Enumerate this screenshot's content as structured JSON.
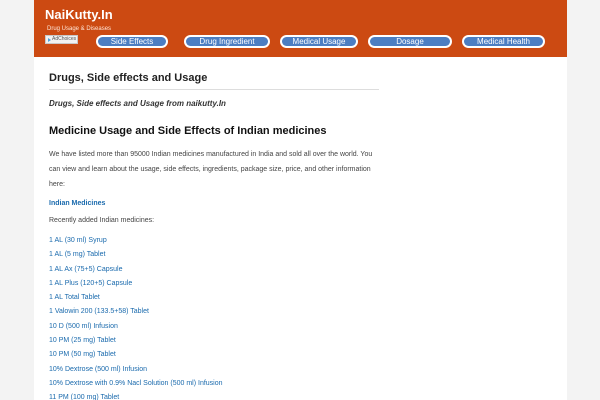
{
  "site": {
    "logo": "NaiKutty.In",
    "tagline": "Drug Usage & Diseases",
    "adchoices": "AdChoices"
  },
  "nav": [
    {
      "label": "Side Effects"
    },
    {
      "label": "Drug Ingredient"
    },
    {
      "label": "Medical Usage"
    },
    {
      "label": "Dosage"
    },
    {
      "label": "Medical Health"
    }
  ],
  "main": {
    "title": "Drugs, Side effects and Usage",
    "subtitle": "Drugs, Side effects and Usage from naikutty.In",
    "heading": "Medicine Usage and Side Effects of Indian medicines",
    "intro": "We have listed more than 95000 Indian medicines manufactured in India and sold all over the world. You can view and learn about the usage, side effects, ingredients, package size, price, and other information here:",
    "category_link": "Indian Medicines",
    "recent_label": "Recently added Indian medicines:",
    "medicines": [
      "1 AL (30 ml) Syrup",
      "1 AL (5 mg) Tablet",
      "1 AL Ax (75+5) Capsule",
      "1 AL Plus (120+5) Capsule",
      "1 AL Total Tablet",
      "1 Valowin 200 (133.5+58) Tablet",
      "10 D (500 ml) Infusion",
      "10 PM (25 mg) Tablet",
      "10 PM (50 mg) Tablet",
      "10% Dextrose (500 ml) Infusion",
      "10% Dextrose with 0.9% Nacl Solution (500 ml) Infusion",
      "11 PM (100 mg) Tablet"
    ]
  },
  "colors": {
    "header_bg": "#cc4a12",
    "nav_pill": "#4c7ec2",
    "link": "#1a6aad",
    "page_bg": "#f3f3f3"
  }
}
